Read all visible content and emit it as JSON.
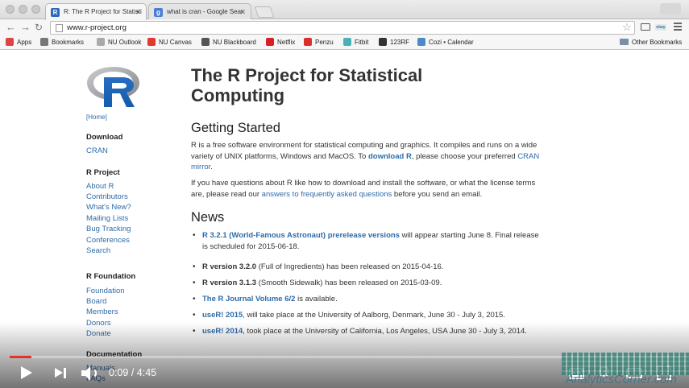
{
  "browser": {
    "tabs": [
      {
        "title": "R: The R Project for Statisti",
        "active": true,
        "favicon": "R"
      },
      {
        "title": "what is cran - Google Sear",
        "active": false,
        "favicon": "g"
      }
    ],
    "address_bar": {
      "url": "www.r-project.org"
    },
    "bookmarks": [
      {
        "label": "Apps",
        "icon": "apps-grid-icon",
        "color": "#d44"
      },
      {
        "label": "Bookmarks",
        "icon": "star-icon",
        "color": "#777"
      },
      {
        "label": "NU Outlook",
        "icon": "page-icon",
        "color": "#aaa"
      },
      {
        "label": "NU Canvas",
        "icon": "canvas-icon",
        "color": "#e03a2f"
      },
      {
        "label": "NU Blackboard",
        "icon": "blackboard-icon",
        "color": "#555"
      },
      {
        "label": "Netflix",
        "icon": "netflix-icon",
        "color": "#d81f26"
      },
      {
        "label": "Penzu",
        "icon": "penzu-icon",
        "color": "#d9302c"
      },
      {
        "label": "Fitbit",
        "icon": "fitbit-icon",
        "color": "#4ab0b5"
      },
      {
        "label": "123RF",
        "icon": "123rf-icon",
        "color": "#333"
      },
      {
        "label": "Cozi • Calendar",
        "icon": "cozi-icon",
        "color": "#4a8ac8"
      }
    ],
    "other_bookmarks": "Other Bookmarks"
  },
  "page": {
    "home_link": "[Home]",
    "sidebar": [
      {
        "type": "head",
        "text": "Download"
      },
      {
        "type": "link",
        "text": "CRAN"
      },
      {
        "type": "head",
        "text": "R Project"
      },
      {
        "type": "link",
        "text": "About R"
      },
      {
        "type": "link",
        "text": "Contributors"
      },
      {
        "type": "link",
        "text": "What's New?"
      },
      {
        "type": "link",
        "text": "Mailing Lists"
      },
      {
        "type": "link",
        "text": "Bug Tracking"
      },
      {
        "type": "link",
        "text": "Conferences"
      },
      {
        "type": "link",
        "text": "Search"
      },
      {
        "type": "head",
        "text": "R Foundation"
      },
      {
        "type": "link",
        "text": "Foundation"
      },
      {
        "type": "link",
        "text": "Board"
      },
      {
        "type": "link",
        "text": "Members"
      },
      {
        "type": "link",
        "text": "Donors"
      },
      {
        "type": "link",
        "text": "Donate"
      },
      {
        "type": "head",
        "text": "Documentation"
      },
      {
        "type": "link",
        "text": "Manuals"
      },
      {
        "type": "link",
        "text": "FAQs"
      }
    ],
    "title": "The R Project for Statistical Computing",
    "getting_started": {
      "heading": "Getting Started",
      "p1": {
        "pre": "R is a free software environment for statistical computing and graphics. It compiles and runs on a wide variety of UNIX platforms, Windows and MacOS. To ",
        "link1": "download R",
        "mid": ", please choose your preferred ",
        "link2": "CRAN mirror",
        "post": "."
      },
      "p2": {
        "pre": "If you have questions about R like how to download and install the software, or what the license terms are, please read our ",
        "link": "answers to frequently asked questions",
        "post": " before you send an email."
      }
    },
    "news": {
      "heading": "News",
      "items": [
        {
          "lead": "R 3.2.1 (World-Famous Astronaut) prerelease versions",
          "lead_link": true,
          "rest": " will appear starting June 8. Final release is scheduled for 2015-06-18."
        },
        {
          "lead": "R version 3.2.0",
          "lead_link": false,
          "rest": " (Full of Ingredients) has been released on 2015-04-16."
        },
        {
          "lead": "R version 3.1.3",
          "lead_link": false,
          "rest": " (Smooth Sidewalk) has been released on 2015-03-09."
        },
        {
          "lead": "The R Journal Volume 6/2",
          "lead_link": true,
          "rest": " is available."
        },
        {
          "lead": "useR! 2015",
          "lead_link": true,
          "rest": ", will take place at the University of Aalborg, Denmark, June 30 - July 3, 2015."
        },
        {
          "lead": "useR! 2014",
          "lead_link": true,
          "rest": ", took place at the University of California, Los Angeles, USA June 30 - July 3, 2014."
        }
      ]
    }
  },
  "player": {
    "time_current": "0:09",
    "time_total": "4:45",
    "time_sep": " / ",
    "progress_fraction": 0.032,
    "watermark": "AnalyticsCorner.com",
    "accent_color": "#e33322"
  }
}
